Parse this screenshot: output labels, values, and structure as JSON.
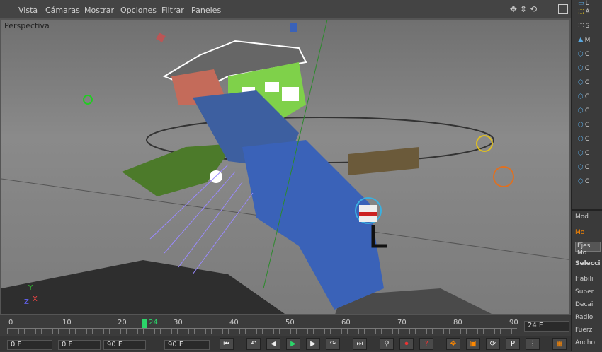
{
  "menu": [
    "Vista",
    "Cámaras",
    "Mostrar",
    "Opciones",
    "Filtrar",
    "Paneles"
  ],
  "viewport": {
    "label": "Perspectiva",
    "axes": {
      "x": "X",
      "y": "Y",
      "z": "Z"
    }
  },
  "timeline": {
    "ticks": [
      "0",
      "10",
      "20",
      "30",
      "40",
      "50",
      "60",
      "70",
      "80",
      "90"
    ],
    "current_frame": "24",
    "fps": "24 F"
  },
  "bottom": {
    "frame_start": "0 F",
    "range_start": "0 F",
    "range_end": "90 F",
    "range_end2": "90 F"
  },
  "objects": [
    "L",
    "A",
    "S",
    "M",
    "C",
    "C",
    "C",
    "C",
    "C",
    "C",
    "C",
    "C",
    "C",
    "C"
  ],
  "attributes": {
    "header": "Mod",
    "mode_label": "Mo",
    "tag": "Ejes Mo",
    "section": "Selecci",
    "props": [
      "Habili",
      "Super",
      "Decai",
      "Radio",
      "Fuerz",
      "Ancho"
    ]
  },
  "colors": {
    "accent": "#2bd56a",
    "viewport_bg": "#7a7a7a"
  }
}
